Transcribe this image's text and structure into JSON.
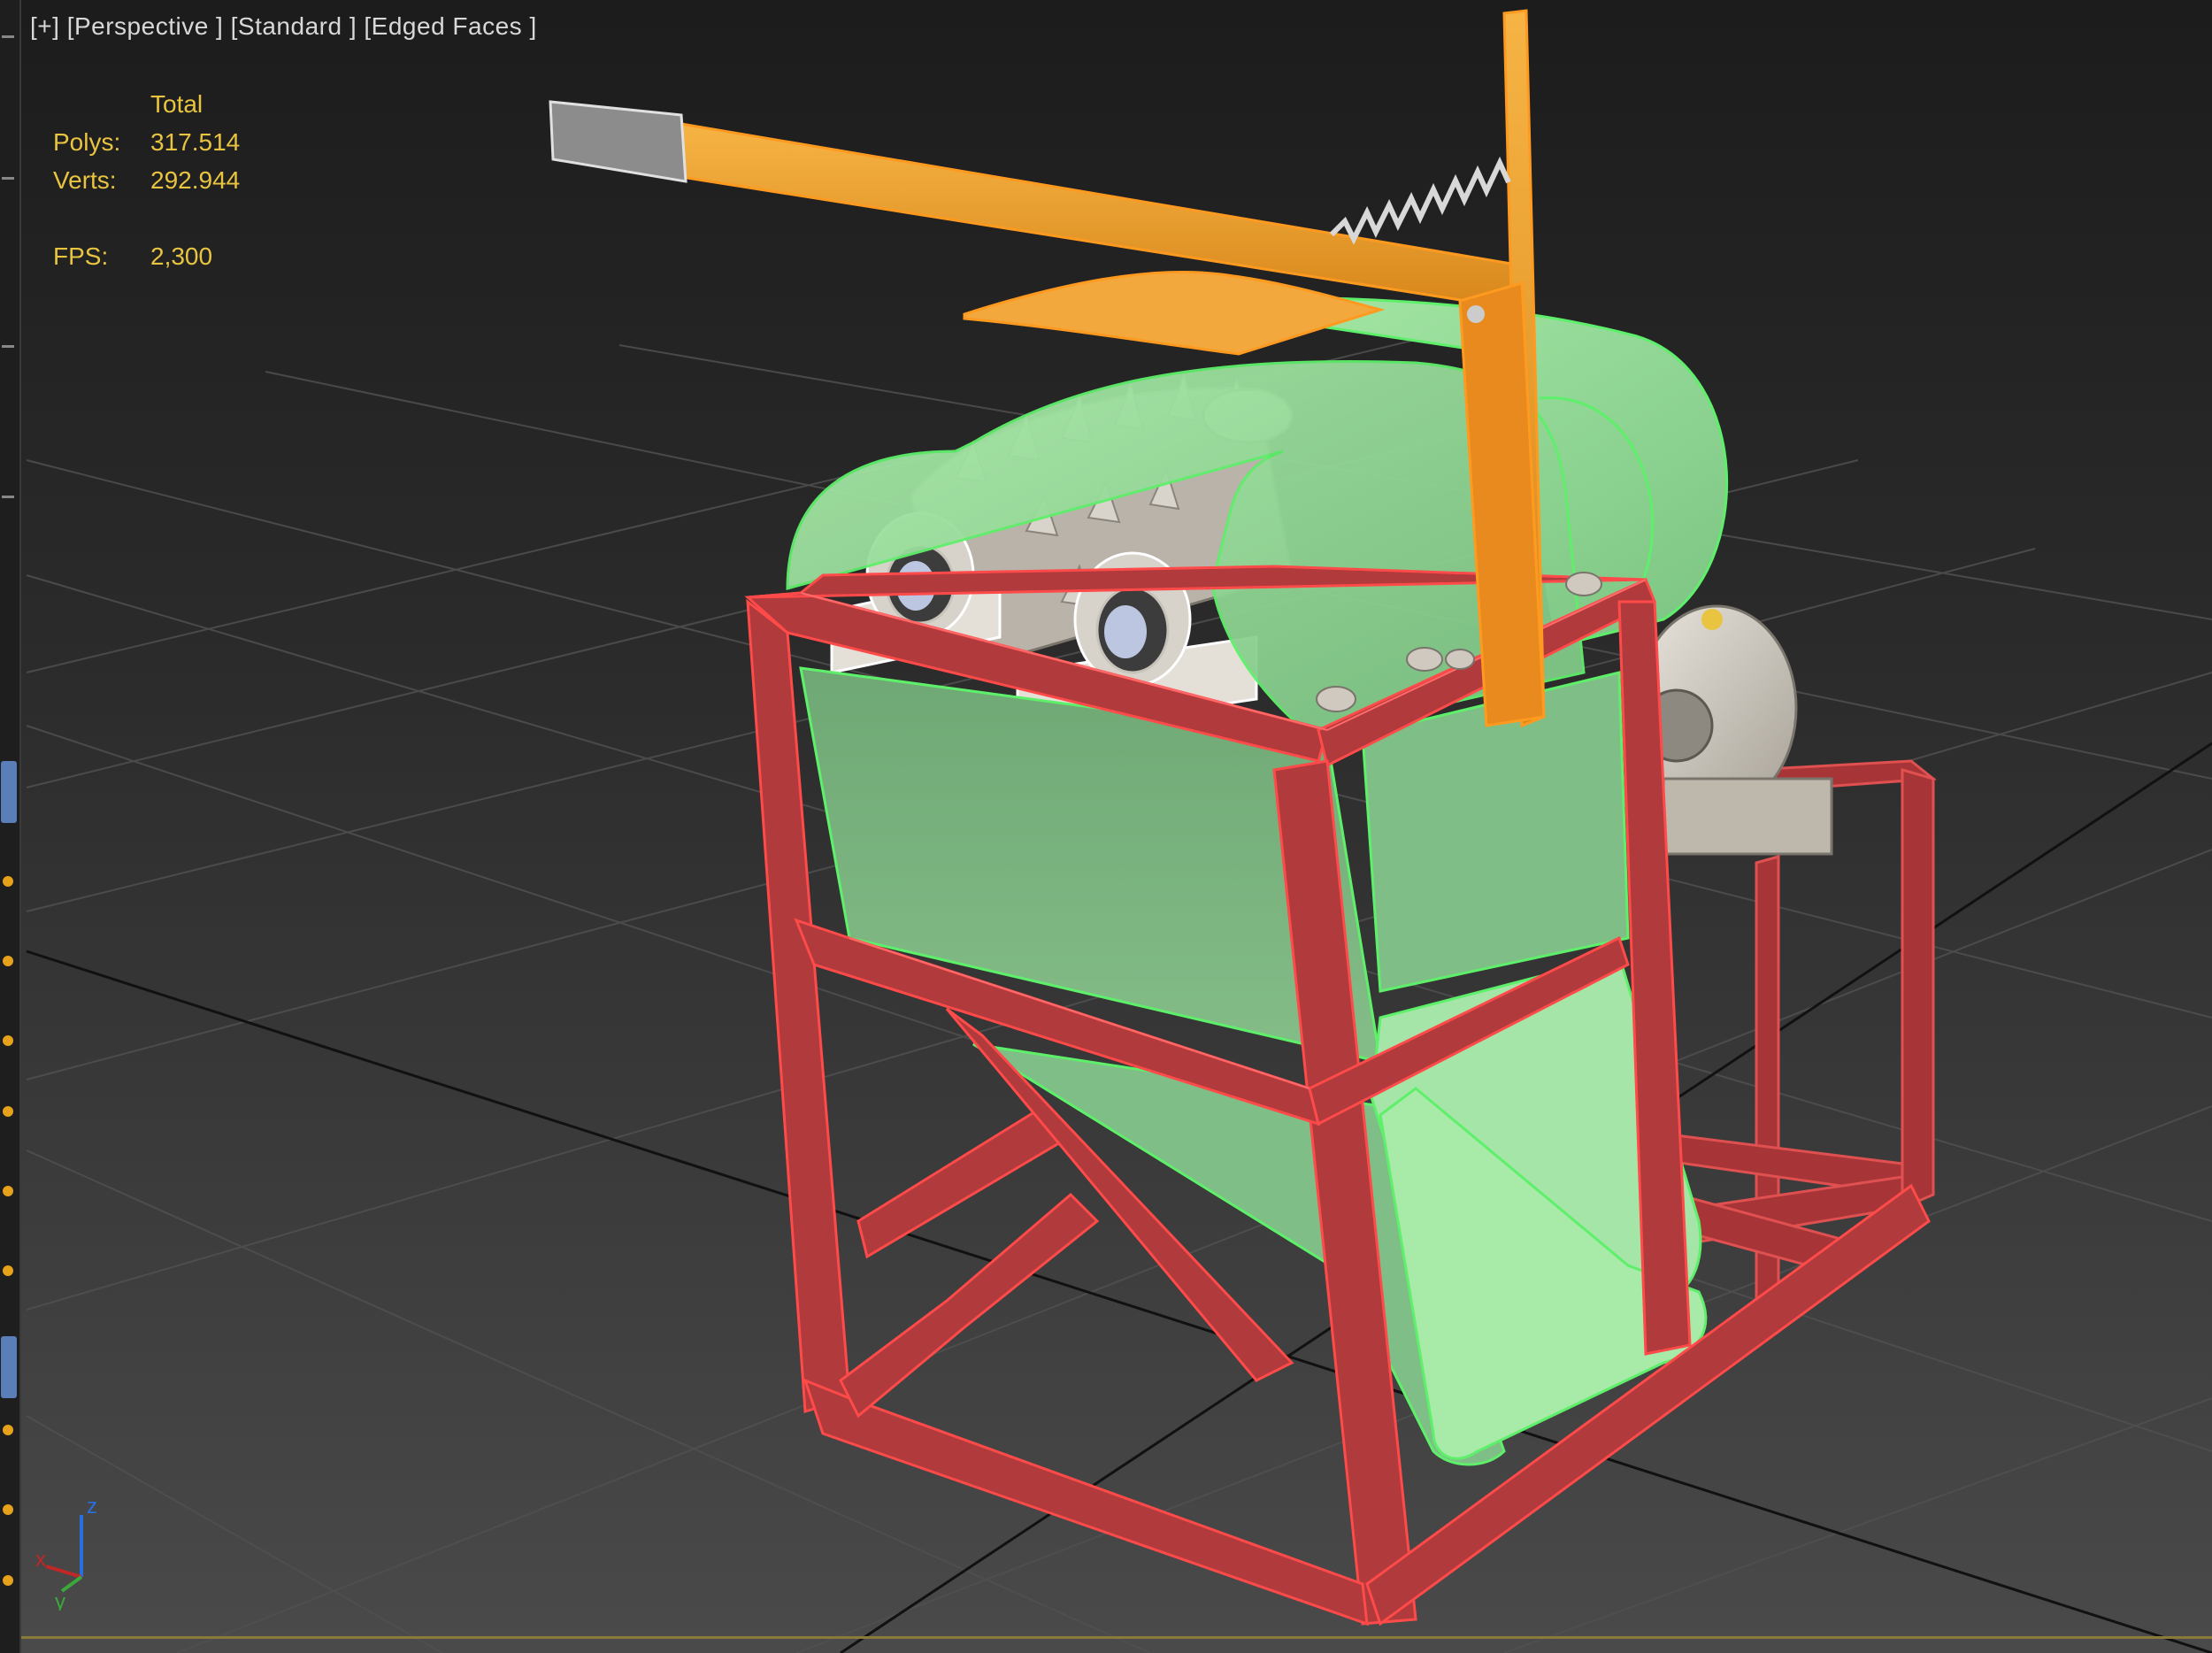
{
  "viewport": {
    "label_plus": "[+]",
    "label_view": "[Perspective ]",
    "label_shading": "[Standard ]",
    "label_edges": "[Edged Faces ]"
  },
  "stats": {
    "header": "Total",
    "polys_label": "Polys:",
    "polys_value": "317.514",
    "verts_label": "Verts:",
    "verts_value": "292.944",
    "fps_label": "FPS:",
    "fps_value": "2,300"
  },
  "axis_gizmo": {
    "z": "z",
    "x": "x",
    "y": "y"
  },
  "colors": {
    "background": "#2b2b2b",
    "grid": "#4a4a4a",
    "frame_red": "#c0393b",
    "hopper_green": "#9fe0a2",
    "lever_orange": "#f0a030",
    "stats_yellow": "#e8c440",
    "metal_grey": "#cfc9bf"
  }
}
